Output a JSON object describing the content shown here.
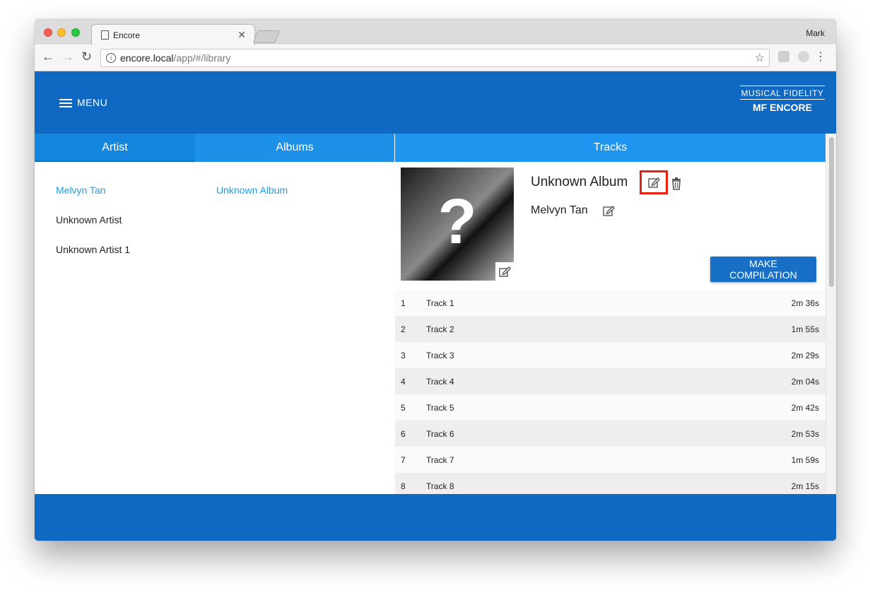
{
  "browser": {
    "tab_title": "Encore",
    "profile_name": "Mark",
    "url_host": "encore.local",
    "url_path": "/app/#/library"
  },
  "header": {
    "menu_label": "MENU",
    "logo_line1": "MUSICAL FIDELITY",
    "logo_line2": "MF ENCORE"
  },
  "columns": {
    "artist": "Artist",
    "albums": "Albums",
    "tracks": "Tracks"
  },
  "artists": [
    {
      "name": "Melvyn Tan",
      "active": true
    },
    {
      "name": "Unknown Artist",
      "active": false
    },
    {
      "name": "Unknown Artist 1",
      "active": false
    }
  ],
  "albums": [
    {
      "name": "Unknown Album",
      "active": true
    }
  ],
  "album_detail": {
    "cover_placeholder": "?",
    "title": "Unknown Album",
    "artist": "Melvyn Tan",
    "compilation_button": "MAKE COMPILATION"
  },
  "tracks": [
    {
      "num": "1",
      "name": "Track 1",
      "duration": "2m 36s"
    },
    {
      "num": "2",
      "name": "Track 2",
      "duration": "1m 55s"
    },
    {
      "num": "3",
      "name": "Track 3",
      "duration": "2m 29s"
    },
    {
      "num": "4",
      "name": "Track 4",
      "duration": "2m 04s"
    },
    {
      "num": "5",
      "name": "Track 5",
      "duration": "2m 42s"
    },
    {
      "num": "6",
      "name": "Track 6",
      "duration": "2m 53s"
    },
    {
      "num": "7",
      "name": "Track 7",
      "duration": "1m 59s"
    },
    {
      "num": "8",
      "name": "Track 8",
      "duration": "2m 15s"
    }
  ],
  "colors": {
    "brand_blue": "#0f68c1",
    "active_link": "#1ca0e4",
    "highlight_red": "#e8210f"
  }
}
